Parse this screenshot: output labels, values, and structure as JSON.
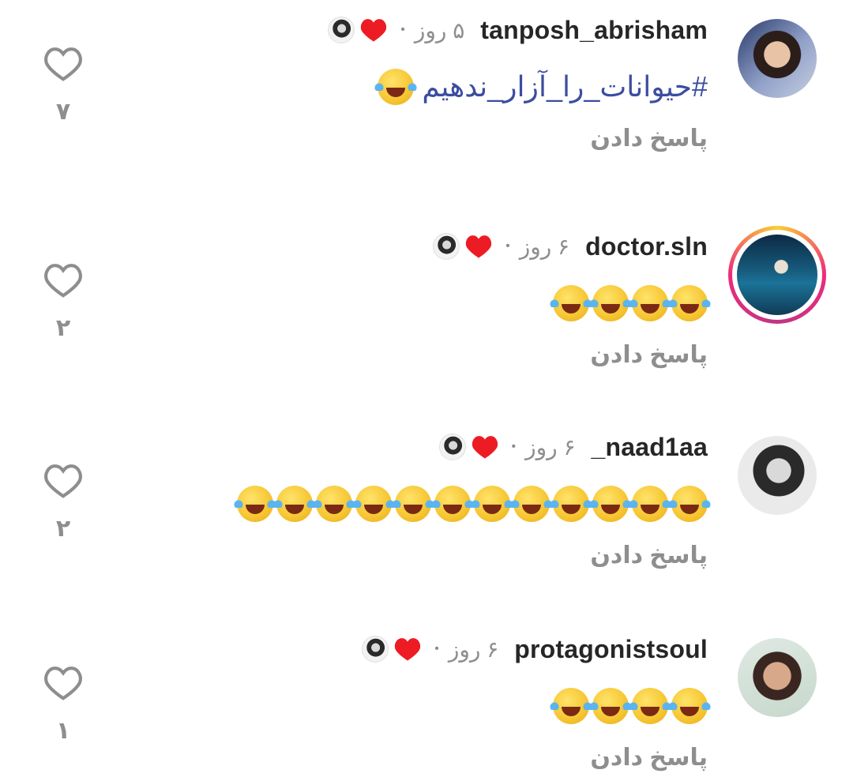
{
  "comments": [
    {
      "username": "tanposh_abrisham",
      "time": "۵ روز",
      "hashtag": "#حیوانات_را_آزار_ندهیم",
      "emoji_count": 1,
      "reply_label": "پاسخ دادن",
      "like_count": "۷",
      "story_ring": false
    },
    {
      "username": "doctor.sln",
      "time": "۶ روز",
      "emoji_count": 4,
      "reply_label": "پاسخ دادن",
      "like_count": "۲",
      "story_ring": true
    },
    {
      "username": "_naad1aa",
      "time": "۶ روز",
      "emoji_count": 12,
      "reply_label": "پاسخ دادن",
      "like_count": "۲",
      "story_ring": false
    },
    {
      "username": "protagonistsoul",
      "time": "۶ روز",
      "emoji_count": 4,
      "reply_label": "پاسخ دادن",
      "like_count": "۱",
      "story_ring": false
    }
  ],
  "icons": {
    "emoji": "face-with-tears-of-joy-icon",
    "author_like": "red-heart-icon",
    "like": "heart-outline-icon"
  },
  "colors": {
    "hashtag": "#3b4da0",
    "heart": "#ed1c24",
    "muted": "#8e8e8e",
    "text": "#262626"
  }
}
